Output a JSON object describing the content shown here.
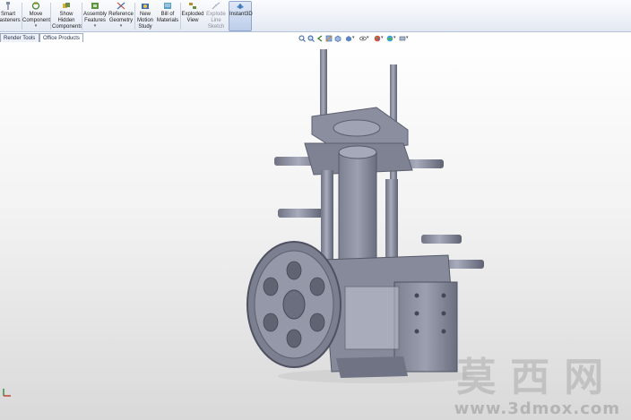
{
  "ribbon": {
    "buttons": [
      {
        "label": "Smart\nFasteners",
        "dropdown": false,
        "icon": "smart-fasteners-icon"
      },
      {
        "label": "Move\nComponent",
        "dropdown": true,
        "icon": "move-component-icon"
      },
      {
        "label": "Show\nHidden\nComponents",
        "dropdown": false,
        "icon": "show-hidden-icon"
      },
      {
        "label": "Assembly\nFeatures",
        "dropdown": true,
        "icon": "assembly-features-icon"
      },
      {
        "label": "Reference\nGeometry",
        "dropdown": true,
        "icon": "reference-geometry-icon"
      },
      {
        "label": "New\nMotion\nStudy",
        "dropdown": false,
        "icon": "motion-study-icon"
      },
      {
        "label": "Bill of\nMaterials",
        "dropdown": false,
        "icon": "bom-icon"
      },
      {
        "label": "Exploded\nView",
        "dropdown": false,
        "icon": "exploded-view-icon"
      },
      {
        "label": "Explode\nLine\nSketch",
        "dropdown": false,
        "icon": "explode-line-icon",
        "disabled": true
      },
      {
        "label": "Instant3D",
        "dropdown": false,
        "icon": "instant3d-icon",
        "active": true
      }
    ]
  },
  "tabs": [
    "Render Tools",
    "Office Products"
  ],
  "watermark": {
    "cn": "莫西网",
    "url": "www.3dmox.com"
  },
  "colors": {
    "ribbon_top": "#fbfcfe",
    "ribbon_bottom": "#e3e9f3",
    "model": "#8f93a3",
    "model_dark": "#5b5f6e",
    "accent": "#bccde9"
  }
}
